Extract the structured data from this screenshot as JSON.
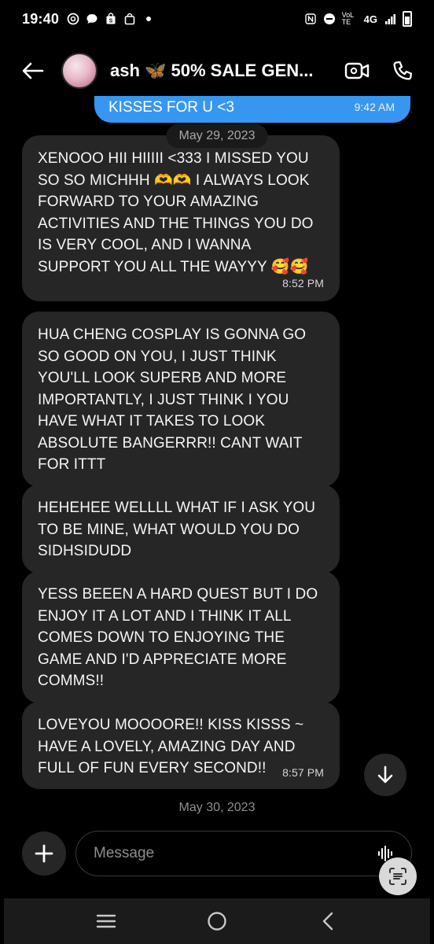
{
  "status_bar": {
    "time": "19:40",
    "network_label": "4G",
    "volte_label": "VoLTE"
  },
  "header": {
    "back_icon": "arrow-left-icon",
    "title": "ash 🦋 50% SALE GEN...",
    "video_icon": "video-call-icon",
    "phone_icon": "phone-icon"
  },
  "messages": {
    "sent_preview": {
      "text": "KISSES FOR U <3",
      "time": "9:42 AM"
    },
    "date_1": "May 29, 2023",
    "received": [
      {
        "text": "XENOOO HII HIIIII <333 I MISSED YOU SO SO MICHHH 🫶🫶 I ALWAYS LOOK FORWARD TO YOUR AMAZING ACTIVITIES AND THE THINGS YOU DO IS VERY COOL, AND I WANNA SUPPORT YOU ALL THE WAYYY 🥰🥰",
        "time": "8:52 PM"
      },
      {
        "text": "HUA CHENG COSPLAY IS GONNA GO SO GOOD ON YOU, I JUST THINK YOU'LL LOOK SUPERB AND MORE IMPORTANTLY, I JUST THINK I YOU HAVE WHAT IT TAKES TO LOOK ABSOLUTE BANGERRR!! CANT WAIT FOR ITTT",
        "time": ""
      },
      {
        "text": "HEHEHEE WELLLL WHAT IF I ASK YOU TO BE MINE, WHAT WOULD YOU DO SIDHSIDUDD",
        "time": ""
      },
      {
        "text": "YESS BEEEN A HARD QUEST BUT I DO ENJOY IT A LOT AND I THINK IT ALL COMES DOWN TO ENJOYING THE GAME AND I'D APPRECIATE MORE COMMS!!",
        "time": ""
      },
      {
        "text": "LOVEYOU MOOOORE!! KISS KISSS ~ HAVE A LOVELY, AMAZING DAY AND FULL OF FUN EVERY SECOND!!",
        "time": "8:57 PM"
      }
    ],
    "date_2": "May 30, 2023"
  },
  "composer": {
    "placeholder": "Message",
    "add_icon": "plus-icon",
    "voice_icon": "voice-waveform-icon"
  },
  "colors": {
    "sent_bubble": "#3797f0",
    "received_bubble": "#262626",
    "background": "#000000"
  }
}
